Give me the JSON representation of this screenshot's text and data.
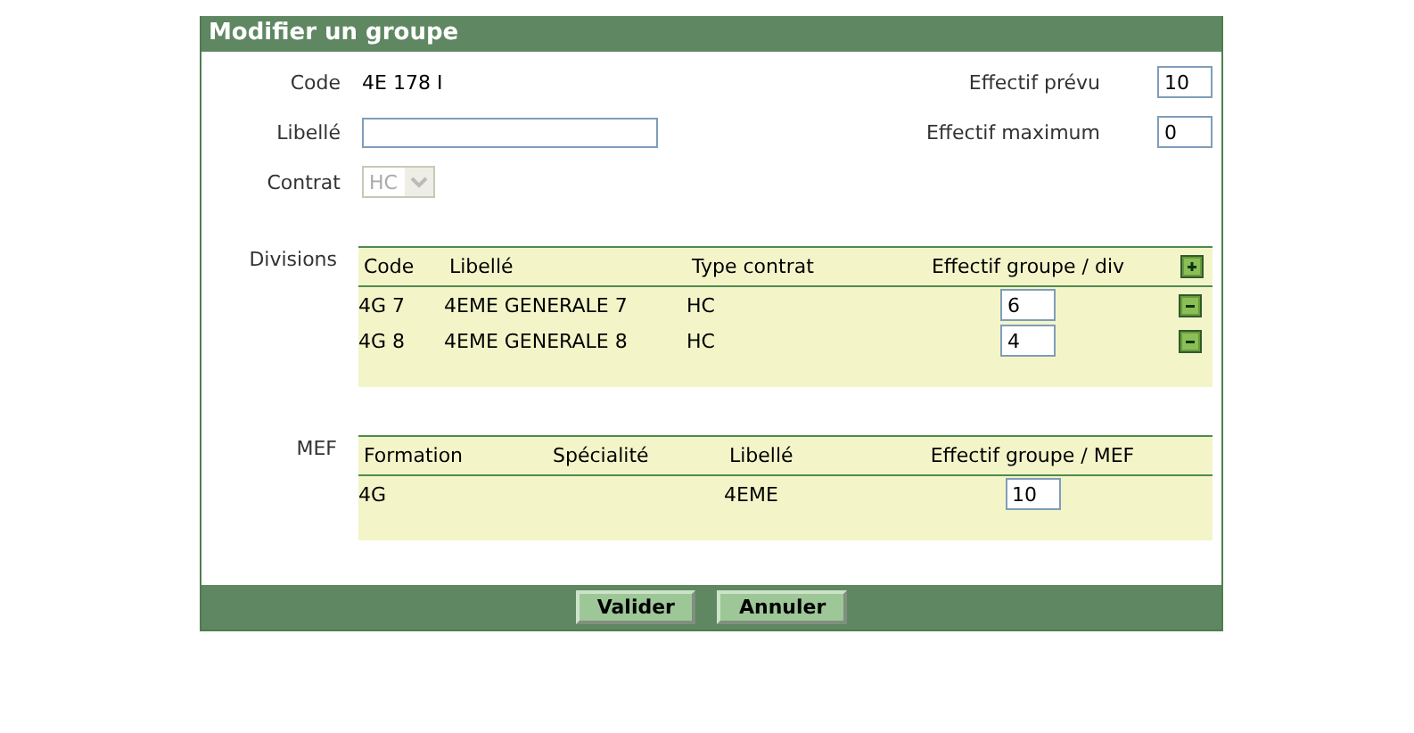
{
  "window": {
    "title": "Modifier un groupe"
  },
  "fields": [
    {
      "label": "Code",
      "kind": "text",
      "value": "4E 178 I"
    },
    {
      "label": "Libellé",
      "kind": "input"
    },
    {
      "label": "Contrat",
      "kind": "select",
      "value": "HC",
      "disabled": true
    }
  ],
  "side_fields": [
    {
      "label": "Effectif prévu",
      "value": "10"
    },
    {
      "label": "Effectif maximum",
      "value": "0"
    }
  ],
  "divisions": {
    "label": "Divisions",
    "columns": [
      "Code",
      "Libellé",
      "Type contrat",
      "Effectif groupe / div"
    ],
    "add_action": true,
    "rows": [
      {
        "cells": [
          "4G 7",
          "4EME GENERALE 7",
          "HC"
        ],
        "value": "6",
        "remove_action": true
      },
      {
        "cells": [
          "4G 8",
          "4EME GENERALE 8",
          "HC"
        ],
        "value": "4",
        "remove_action": true
      }
    ]
  },
  "mef": {
    "label": "MEF",
    "columns": [
      "Formation",
      "Spécialité",
      "Libellé",
      "Effectif groupe / MEF"
    ],
    "add_action": false,
    "rows": [
      {
        "cells": [
          "4G",
          "",
          "4EME"
        ],
        "value": "10",
        "remove_action": false
      }
    ]
  },
  "buttons": [
    "Valider",
    "Annuler"
  ]
}
